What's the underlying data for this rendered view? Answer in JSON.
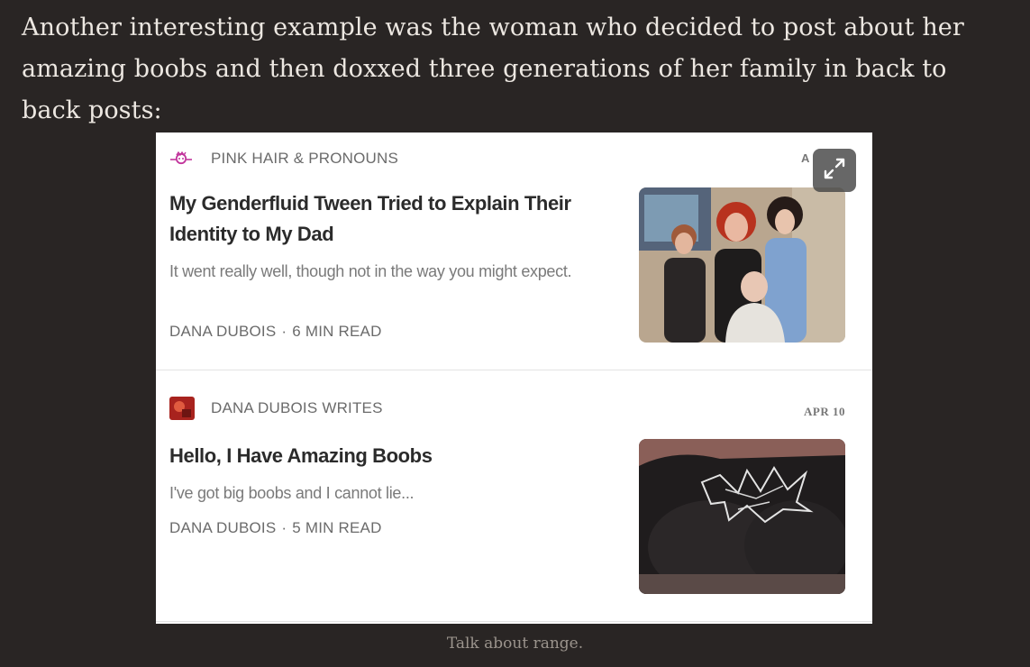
{
  "article": {
    "paragraph": "Another interesting example was the woman who decided to post about her amazing boobs and then doxxed three generations of her family in back to back posts:",
    "caption": "Talk about range."
  },
  "embed": {
    "expand_icon": "expand-arrows-icon",
    "partial_date": "A",
    "posts": [
      {
        "publication": "PINK HAIR & PRONOUNS",
        "publication_icon": "pink-hair-logo-icon",
        "title": "My Genderfluid Tween Tried to Explain Their Identity to My Dad",
        "subtitle": "It went really well, though not in the way you might expect.",
        "author": "DANA DUBOIS",
        "separator": "·",
        "read_time": "6 MIN READ",
        "thumbnail": "family-photo"
      },
      {
        "publication": "DANA DUBOIS WRITES",
        "publication_icon": "dana-dubois-avatar-icon",
        "date": "APR 10",
        "title": "Hello, I Have Amazing Boobs",
        "subtitle": "I've got big boobs and I cannot lie...",
        "author": "DANA DUBOIS",
        "separator": "·",
        "read_time": "5 MIN READ",
        "thumbnail": "black-tshirt-photo"
      }
    ]
  },
  "colors": {
    "page_background": "#292524",
    "body_text": "#ece7e1",
    "caption_text": "#9b948d",
    "card_background": "#ffffff",
    "pink_accent": "#c2359c"
  }
}
